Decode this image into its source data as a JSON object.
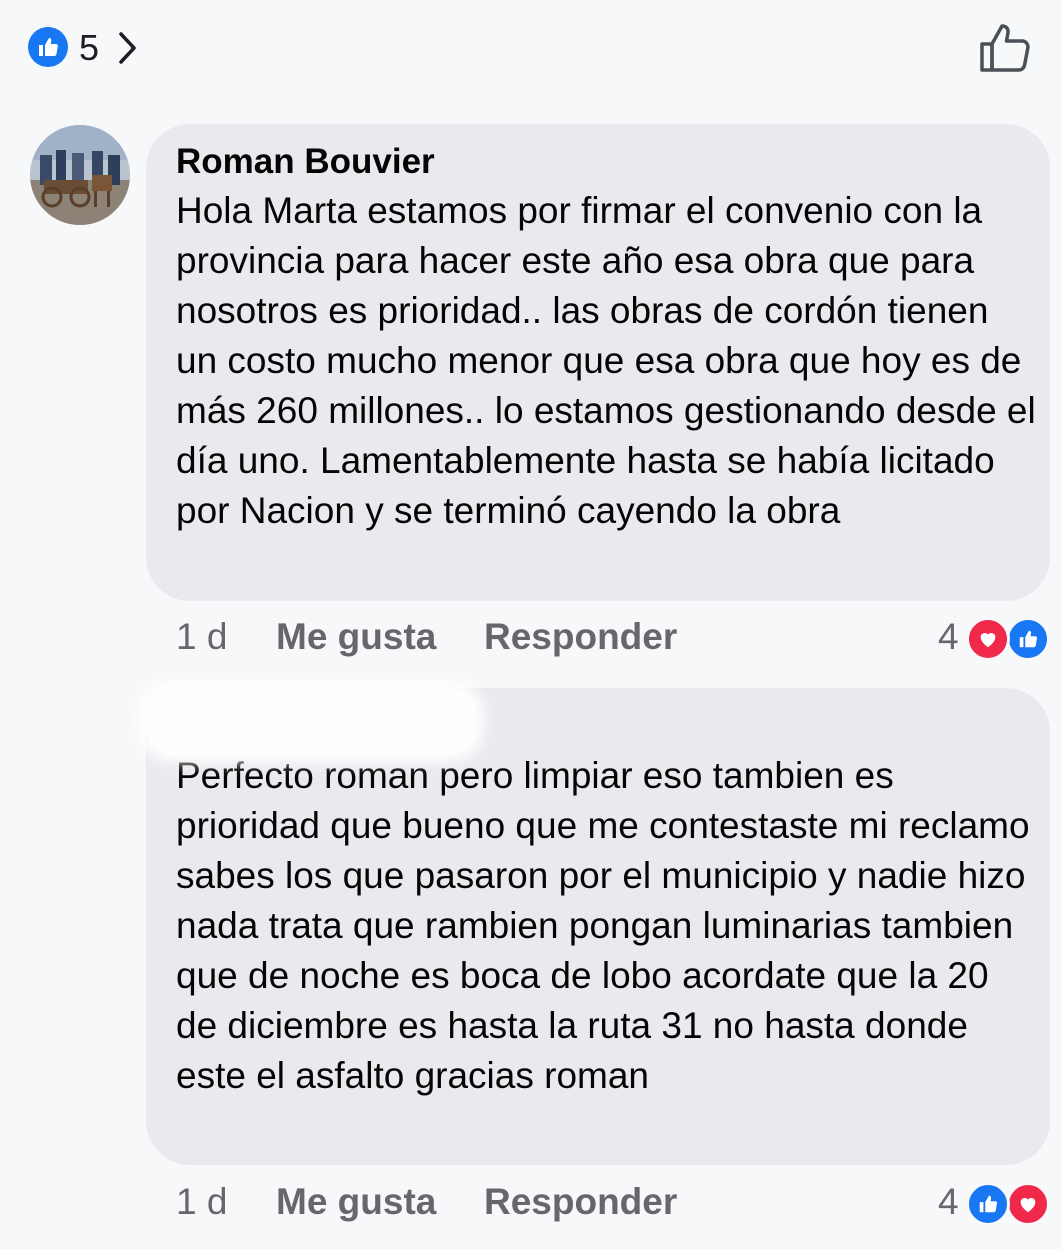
{
  "header": {
    "reaction_count": "5",
    "reaction_icon": "like-icon",
    "chevron_icon": "chevron-right-icon",
    "like_button_icon": "thumbs-up-outline-icon"
  },
  "comments": [
    {
      "author": "Roman Bouvier",
      "text": "Hola Marta estamos por firmar el convenio con la provincia para hacer este año esa obra que para nosotros es prioridad.. las obras de cordón tienen un costo mucho menor que esa obra que hoy es de más 260 millones.. lo estamos gestionando desde el día uno. Lamentablemente hasta se había licitado por Nacion y se terminó cayendo la obra",
      "time": "1 d",
      "like_label": "Me gusta",
      "reply_label": "Responder",
      "reaction_count": "4",
      "reactions": [
        "heart-icon",
        "like-icon"
      ]
    },
    {
      "author": "",
      "text": "Perfecto roman pero limpiar eso tambien es prioridad que bueno que me contestaste mi reclamo sabes los que pasaron por el municipio y nadie hizo nada trata que rambien pongan luminarias tambien que de noche es boca de lobo acordate que la 20 de diciembre es hasta la ruta 31 no hasta donde este el asfalto gracias roman",
      "time": "1 d",
      "like_label": "Me gusta",
      "reply_label": "Responder",
      "reaction_count": "4",
      "reactions": [
        "like-icon",
        "heart-icon"
      ]
    }
  ],
  "colors": {
    "background": "#f7f8fa",
    "bubble": "#e9eaee",
    "like_blue": "#1877f2",
    "heart_red": "#f02849",
    "meta_gray": "#65676b"
  }
}
